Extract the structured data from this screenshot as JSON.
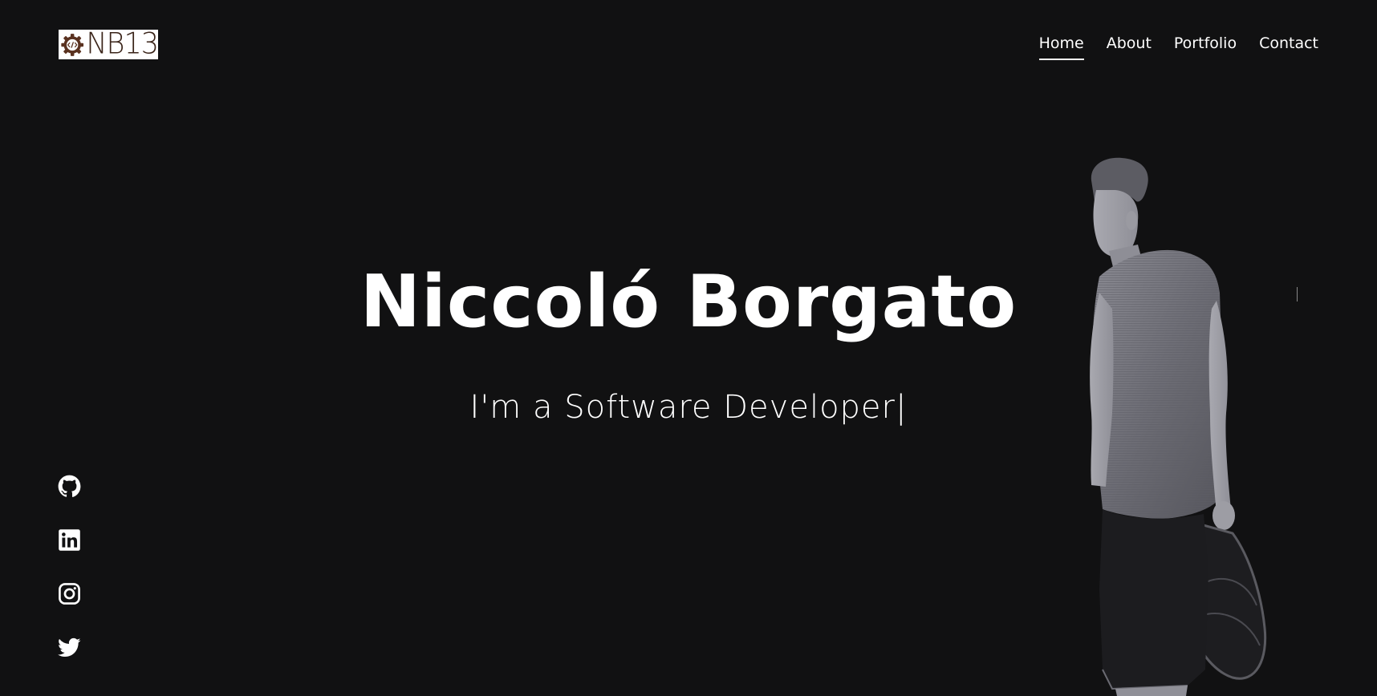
{
  "logo": {
    "text": "NB13",
    "icon": "gear-code-icon",
    "colors": {
      "background": "#ffffff",
      "ink": "#3a2419"
    }
  },
  "nav": {
    "items": [
      {
        "label": "Home",
        "active": true
      },
      {
        "label": "About",
        "active": false
      },
      {
        "label": "Portfolio",
        "active": false
      },
      {
        "label": "Contact",
        "active": false
      }
    ]
  },
  "hero": {
    "name": "Niccoló Borgato",
    "subtitle": "I'm a Software Developer",
    "cursor": "|"
  },
  "socials": [
    {
      "name": "github",
      "icon": "github-icon"
    },
    {
      "name": "linkedin",
      "icon": "linkedin-icon"
    },
    {
      "name": "instagram",
      "icon": "instagram-icon"
    },
    {
      "name": "twitter",
      "icon": "twitter-icon"
    }
  ],
  "colors": {
    "background": "#111112",
    "text": "#ffffff",
    "photo_tone": "#7a7a82"
  }
}
